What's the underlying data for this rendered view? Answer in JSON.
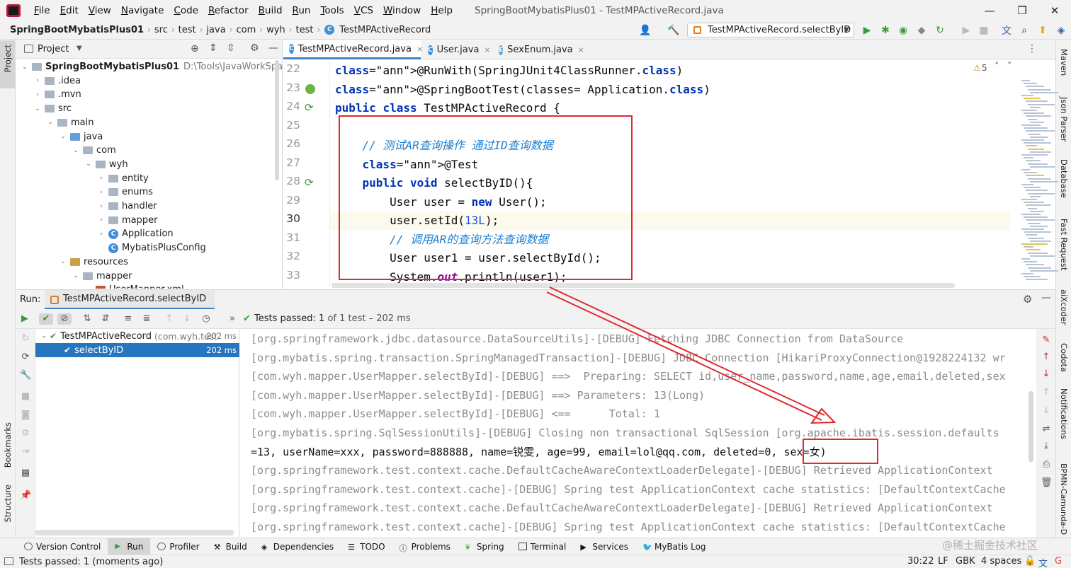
{
  "window": {
    "title": "SpringBootMybatisPlus01 - TestMPActiveRecord.java",
    "menu": [
      "File",
      "Edit",
      "View",
      "Navigate",
      "Code",
      "Refactor",
      "Build",
      "Run",
      "Tools",
      "VCS",
      "Window",
      "Help"
    ],
    "controls": {
      "minimize": "—",
      "maximize": "❐",
      "close": "✕"
    }
  },
  "breadcrumb": {
    "project": "SpringBootMybatisPlus01",
    "parts": [
      "src",
      "test",
      "java",
      "com",
      "wyh",
      "test"
    ],
    "file": "TestMPActiveRecord",
    "separator": "›"
  },
  "run_config": {
    "label": "TestMPActiveRecord.selectByID",
    "dropdown": "▼"
  },
  "project_panel": {
    "title": "Project",
    "tree": [
      {
        "label": "SpringBootMybatisPlus01",
        "path": "D:\\Tools\\JavaWorkSpace\\Spring",
        "arrow": "⌄",
        "kind": "folder",
        "bold": true
      },
      {
        "label": ".idea",
        "arrow": "›",
        "kind": "folder"
      },
      {
        "label": ".mvn",
        "arrow": "›",
        "kind": "folder"
      },
      {
        "label": "src",
        "arrow": "⌄",
        "kind": "folder"
      },
      {
        "label": "main",
        "arrow": "⌄",
        "kind": "folder"
      },
      {
        "label": "java",
        "arrow": "⌄",
        "kind": "folder-blue"
      },
      {
        "label": "com",
        "arrow": "⌄",
        "kind": "package"
      },
      {
        "label": "wyh",
        "arrow": "⌄",
        "kind": "package"
      },
      {
        "label": "entity",
        "arrow": "›",
        "kind": "package"
      },
      {
        "label": "enums",
        "arrow": "›",
        "kind": "package"
      },
      {
        "label": "handler",
        "arrow": "›",
        "kind": "package"
      },
      {
        "label": "mapper",
        "arrow": "›",
        "kind": "package"
      },
      {
        "label": "Application",
        "arrow": "›",
        "kind": "class-run"
      },
      {
        "label": "MybatisPlusConfig",
        "arrow": "",
        "kind": "class"
      },
      {
        "label": "resources",
        "arrow": "⌄",
        "kind": "folder-orange"
      },
      {
        "label": "mapper",
        "arrow": "⌄",
        "kind": "folder"
      },
      {
        "label": "UserMapper.xml",
        "arrow": "",
        "kind": "xml"
      }
    ]
  },
  "editor": {
    "tabs": [
      {
        "label": "TestMPActiveRecord.java",
        "close": "×",
        "active": true
      },
      {
        "label": "User.java",
        "close": "×",
        "active": false
      },
      {
        "label": "SexEnum.java",
        "close": "×",
        "active": false
      }
    ],
    "warnings": "5",
    "lines": [
      {
        "n": "22",
        "code": "@RunWith(SpringJUnit4ClassRunner.class)"
      },
      {
        "n": "23",
        "code": "@SpringBootTest(classes= Application.class)"
      },
      {
        "n": "24",
        "code": "public class TestMPActiveRecord {"
      },
      {
        "n": "25",
        "code": ""
      },
      {
        "n": "26",
        "code": "    // 测试AR查询操作 通过ID查询数据"
      },
      {
        "n": "27",
        "code": "    @Test"
      },
      {
        "n": "28",
        "code": "    public void selectByID(){"
      },
      {
        "n": "29",
        "code": "        User user = new User();"
      },
      {
        "n": "30",
        "code": "        user.setId(13L);"
      },
      {
        "n": "31",
        "code": "        // 调用AR的查询方法查询数据"
      },
      {
        "n": "32",
        "code": "        User user1 = user.selectById();"
      },
      {
        "n": "33",
        "code": "        System.out.println(user1);"
      }
    ]
  },
  "run_panel": {
    "label": "Run:",
    "tab": "TestMPActiveRecord.selectByID",
    "status": "Tests passed:",
    "status_count": "1",
    "status_rest": "of 1 test – 202 ms",
    "tree": [
      {
        "label": "TestMPActiveRecord",
        "pkg": "(com.wyh.test",
        "dur": "202 ms"
      },
      {
        "label": "selectByID",
        "dur": "202 ms"
      }
    ],
    "console": [
      "[org.springframework.jdbc.datasource.DataSourceUtils]-[DEBUG] Fetching JDBC Connection from DataSource",
      "[org.mybatis.spring.transaction.SpringManagedTransaction]-[DEBUG] JDBC Connection [HikariProxyConnection@1928224132 wr",
      "[com.wyh.mapper.UserMapper.selectById]-[DEBUG] ==>  Preparing: SELECT id,user_name,password,name,age,email,deleted,sex",
      "[com.wyh.mapper.UserMapper.selectById]-[DEBUG] ==> Parameters: 13(Long)",
      "[com.wyh.mapper.UserMapper.selectById]-[DEBUG] <==      Total: 1",
      "[org.mybatis.spring.SqlSessionUtils]-[DEBUG] Closing non transactional SqlSession [org.apache.ibatis.session.defaults",
      "=13, userName=xxx, password=888888, name=锐雯, age=99, email=lol@qq.com, deleted=0, sex=女)",
      "[org.springframework.test.context.cache.DefaultCacheAwareContextLoaderDelegate]-[DEBUG] Retrieved ApplicationContext",
      "[org.springframework.test.context.cache]-[DEBUG] Spring test ApplicationContext cache statistics: [DefaultContextCache",
      "[org.springframework.test.context.cache.DefaultCacheAwareContextLoaderDelegate]-[DEBUG] Retrieved ApplicationContext",
      "[org.springframework.test.context.cache]-[DEBUG] Spring test ApplicationContext cache statistics: [DefaultContextCache"
    ]
  },
  "tool_windows": [
    "Version Control",
    "Run",
    "Profiler",
    "Build",
    "Dependencies",
    "TODO",
    "Problems",
    "Spring",
    "Terminal",
    "Services",
    "MyBatis Log"
  ],
  "right_tools": [
    "Maven",
    "Json Parser",
    "Database",
    "Fast Request",
    "aiXcoder",
    "Codota",
    "Notifications",
    "BPMN-Camunda-D"
  ],
  "left_tools": [
    "Project",
    "Bookmarks",
    "Structure"
  ],
  "status_bar": {
    "message": "Tests passed: 1 (moments ago)",
    "position": "30:22",
    "line_sep": "LF",
    "encoding": "GBK",
    "indent": "4 spaces"
  },
  "watermark": "@稀土掘金技术社区",
  "colors": {
    "accent": "#4083c9",
    "highlight_box": "#e0282e",
    "selection": "#2675bf"
  }
}
